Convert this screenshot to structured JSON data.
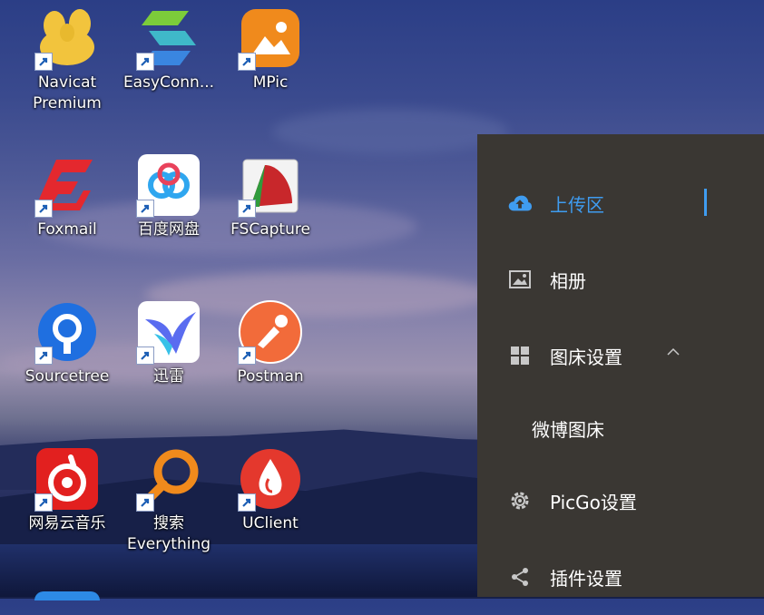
{
  "desktop": {
    "icons": [
      {
        "id": "navicat",
        "label": "Navicat\nPremium",
        "icon": "navicat-icon"
      },
      {
        "id": "easyconnect",
        "label": "EasyConn...",
        "icon": "easyconnect-icon"
      },
      {
        "id": "mpic",
        "label": "MPic",
        "icon": "mpic-icon"
      },
      {
        "id": "foxmail",
        "label": "Foxmail",
        "icon": "foxmail-icon"
      },
      {
        "id": "baidupan",
        "label": "百度网盘",
        "icon": "baidu-netdisk-icon"
      },
      {
        "id": "fscapture",
        "label": "FSCapture",
        "icon": "fscapture-icon"
      },
      {
        "id": "sourcetree",
        "label": "Sourcetree",
        "icon": "sourcetree-icon"
      },
      {
        "id": "xunlei",
        "label": "迅雷",
        "icon": "xunlei-icon"
      },
      {
        "id": "postman",
        "label": "Postman",
        "icon": "postman-icon"
      },
      {
        "id": "netease",
        "label": "网易云音乐",
        "icon": "netease-music-icon"
      },
      {
        "id": "everything",
        "label": "搜索\nEverything",
        "icon": "everything-icon"
      },
      {
        "id": "uclient",
        "label": "UClient",
        "icon": "uclient-icon"
      }
    ]
  },
  "sidebar": {
    "items": [
      {
        "label": "上传区",
        "icon": "cloud-upload-icon",
        "active": true
      },
      {
        "label": "相册",
        "icon": "image-icon"
      },
      {
        "label": "图床设置",
        "icon": "grid-icon",
        "expanded": true
      },
      {
        "label": "微博图床",
        "icon": ""
      },
      {
        "label": "PicGo设置",
        "icon": "gear-icon"
      },
      {
        "label": "插件设置",
        "icon": "share-icon"
      }
    ]
  },
  "colors": {
    "panel_bg": "#3a3733",
    "accent": "#3f9cf0",
    "icon_gray": "#c8c8c8"
  }
}
